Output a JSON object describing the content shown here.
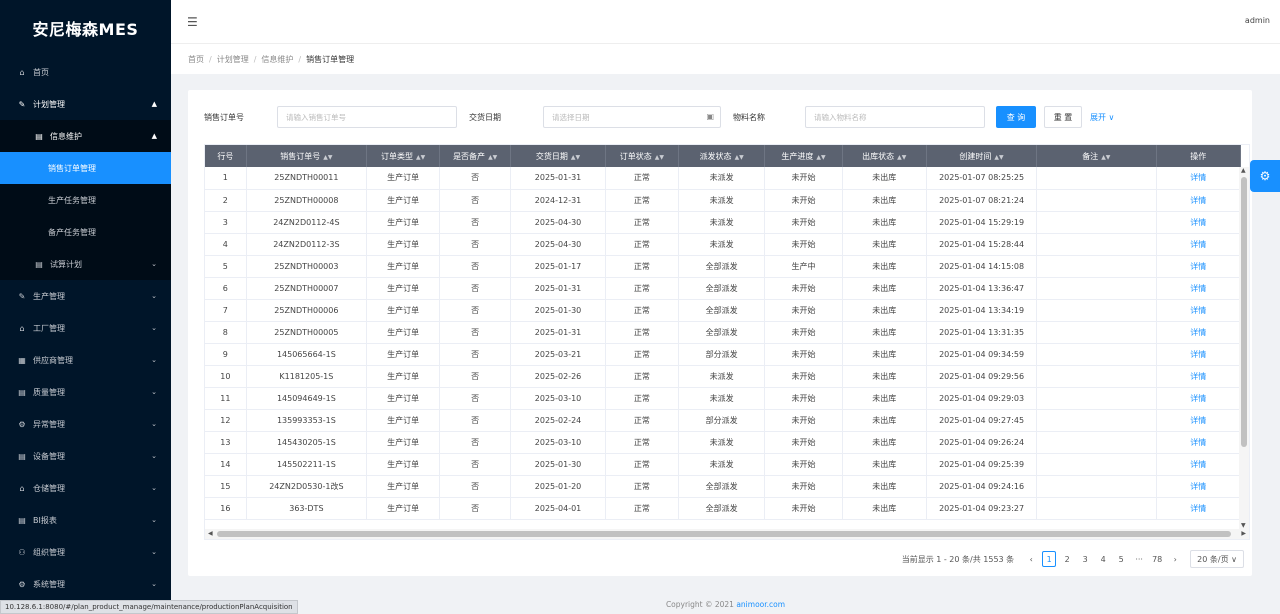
{
  "app": {
    "title": "安尼梅森MES",
    "user": "admin"
  },
  "sidebar": {
    "items": [
      {
        "label": "首页",
        "icon": "home-icon"
      },
      {
        "label": "计划管理",
        "icon": "pen-icon",
        "open": true
      },
      {
        "label": "信息维护",
        "icon": "doc-icon",
        "open": true
      },
      {
        "label": "销售订单管理",
        "active": true
      },
      {
        "label": "生产任务管理"
      },
      {
        "label": "备产任务管理"
      },
      {
        "label": "试算计划",
        "icon": "doc-icon"
      },
      {
        "label": "生产管理",
        "icon": "pen-icon"
      },
      {
        "label": "工厂管理",
        "icon": "home-icon"
      },
      {
        "label": "供应商管理",
        "icon": "grid-icon"
      },
      {
        "label": "质量管理",
        "icon": "doc-icon"
      },
      {
        "label": "异常管理",
        "icon": "gear-icon"
      },
      {
        "label": "设备管理",
        "icon": "doc-icon"
      },
      {
        "label": "仓储管理",
        "icon": "home-icon"
      },
      {
        "label": "BI报表",
        "icon": "doc-icon"
      },
      {
        "label": "组织管理",
        "icon": "people-icon"
      },
      {
        "label": "系统管理",
        "icon": "gear-icon"
      }
    ]
  },
  "breadcrumb": [
    "首页",
    "计划管理",
    "信息维护",
    "销售订单管理"
  ],
  "filters": {
    "order_no_label": "销售订单号",
    "order_no_placeholder": "请输入销售订单号",
    "date_label": "交货日期",
    "date_placeholder": "请选择日期",
    "material_label": "物料名称",
    "material_placeholder": "请输入物料名称",
    "search": "查 询",
    "reset": "重 置",
    "expand": "展开 ∨"
  },
  "table": {
    "columns": [
      "行号",
      "销售订单号",
      "订单类型",
      "是否备产",
      "交货日期",
      "订单状态",
      "派发状态",
      "生产进度",
      "出库状态",
      "创建时间",
      "备注",
      "操作"
    ],
    "rows": [
      [
        "1",
        "25ZNDTH00011",
        "生产订单",
        "否",
        "2025-01-31",
        "正常",
        "未派发",
        "未开始",
        "未出库",
        "2025-01-07 08:25:25",
        "",
        "详情"
      ],
      [
        "2",
        "25ZNDTH00008",
        "生产订单",
        "否",
        "2024-12-31",
        "正常",
        "未派发",
        "未开始",
        "未出库",
        "2025-01-07 08:21:24",
        "",
        "详情"
      ],
      [
        "3",
        "24ZN2D0112-4S",
        "生产订单",
        "否",
        "2025-04-30",
        "正常",
        "未派发",
        "未开始",
        "未出库",
        "2025-01-04 15:29:19",
        "",
        "详情"
      ],
      [
        "4",
        "24ZN2D0112-3S",
        "生产订单",
        "否",
        "2025-04-30",
        "正常",
        "未派发",
        "未开始",
        "未出库",
        "2025-01-04 15:28:44",
        "",
        "详情"
      ],
      [
        "5",
        "25ZNDTH00003",
        "生产订单",
        "否",
        "2025-01-17",
        "正常",
        "全部派发",
        "生产中",
        "未出库",
        "2025-01-04 14:15:08",
        "",
        "详情"
      ],
      [
        "6",
        "25ZNDTH00007",
        "生产订单",
        "否",
        "2025-01-31",
        "正常",
        "全部派发",
        "未开始",
        "未出库",
        "2025-01-04 13:36:47",
        "",
        "详情"
      ],
      [
        "7",
        "25ZNDTH00006",
        "生产订单",
        "否",
        "2025-01-30",
        "正常",
        "全部派发",
        "未开始",
        "未出库",
        "2025-01-04 13:34:19",
        "",
        "详情"
      ],
      [
        "8",
        "25ZNDTH00005",
        "生产订单",
        "否",
        "2025-01-31",
        "正常",
        "全部派发",
        "未开始",
        "未出库",
        "2025-01-04 13:31:35",
        "",
        "详情"
      ],
      [
        "9",
        "145065664-1S",
        "生产订单",
        "否",
        "2025-03-21",
        "正常",
        "部分派发",
        "未开始",
        "未出库",
        "2025-01-04 09:34:59",
        "",
        "详情"
      ],
      [
        "10",
        "K1181205-1S",
        "生产订单",
        "否",
        "2025-02-26",
        "正常",
        "未派发",
        "未开始",
        "未出库",
        "2025-01-04 09:29:56",
        "",
        "详情"
      ],
      [
        "11",
        "145094649-1S",
        "生产订单",
        "否",
        "2025-03-10",
        "正常",
        "未派发",
        "未开始",
        "未出库",
        "2025-01-04 09:29:03",
        "",
        "详情"
      ],
      [
        "12",
        "135993353-1S",
        "生产订单",
        "否",
        "2025-02-24",
        "正常",
        "部分派发",
        "未开始",
        "未出库",
        "2025-01-04 09:27:45",
        "",
        "详情"
      ],
      [
        "13",
        "145430205-1S",
        "生产订单",
        "否",
        "2025-03-10",
        "正常",
        "未派发",
        "未开始",
        "未出库",
        "2025-01-04 09:26:24",
        "",
        "详情"
      ],
      [
        "14",
        "145502211-1S",
        "生产订单",
        "否",
        "2025-01-30",
        "正常",
        "未派发",
        "未开始",
        "未出库",
        "2025-01-04 09:25:39",
        "",
        "详情"
      ],
      [
        "15",
        "24ZN2D0530-1改S",
        "生产订单",
        "否",
        "2025-01-20",
        "正常",
        "全部派发",
        "未开始",
        "未出库",
        "2025-01-04 09:24:16",
        "",
        "详情"
      ],
      [
        "16",
        "363-DTS",
        "生产订单",
        "否",
        "2025-04-01",
        "正常",
        "全部派发",
        "未开始",
        "未出库",
        "2025-01-04 09:23:27",
        "",
        "详情"
      ]
    ]
  },
  "pagination": {
    "summary": "当前显示 1 - 20 条/共 1553 条",
    "pages": [
      "1",
      "2",
      "3",
      "4",
      "5",
      "···",
      "78"
    ],
    "prev": "‹",
    "next": "›",
    "page_size": "20 条/页 ∨"
  },
  "footer": {
    "copyright": "Copyright © 2021 ",
    "brand": "animoor.com"
  },
  "status_url": "10.128.6.1:8080/#/plan_product_manage/maintenance/productionPlanAcquisition"
}
